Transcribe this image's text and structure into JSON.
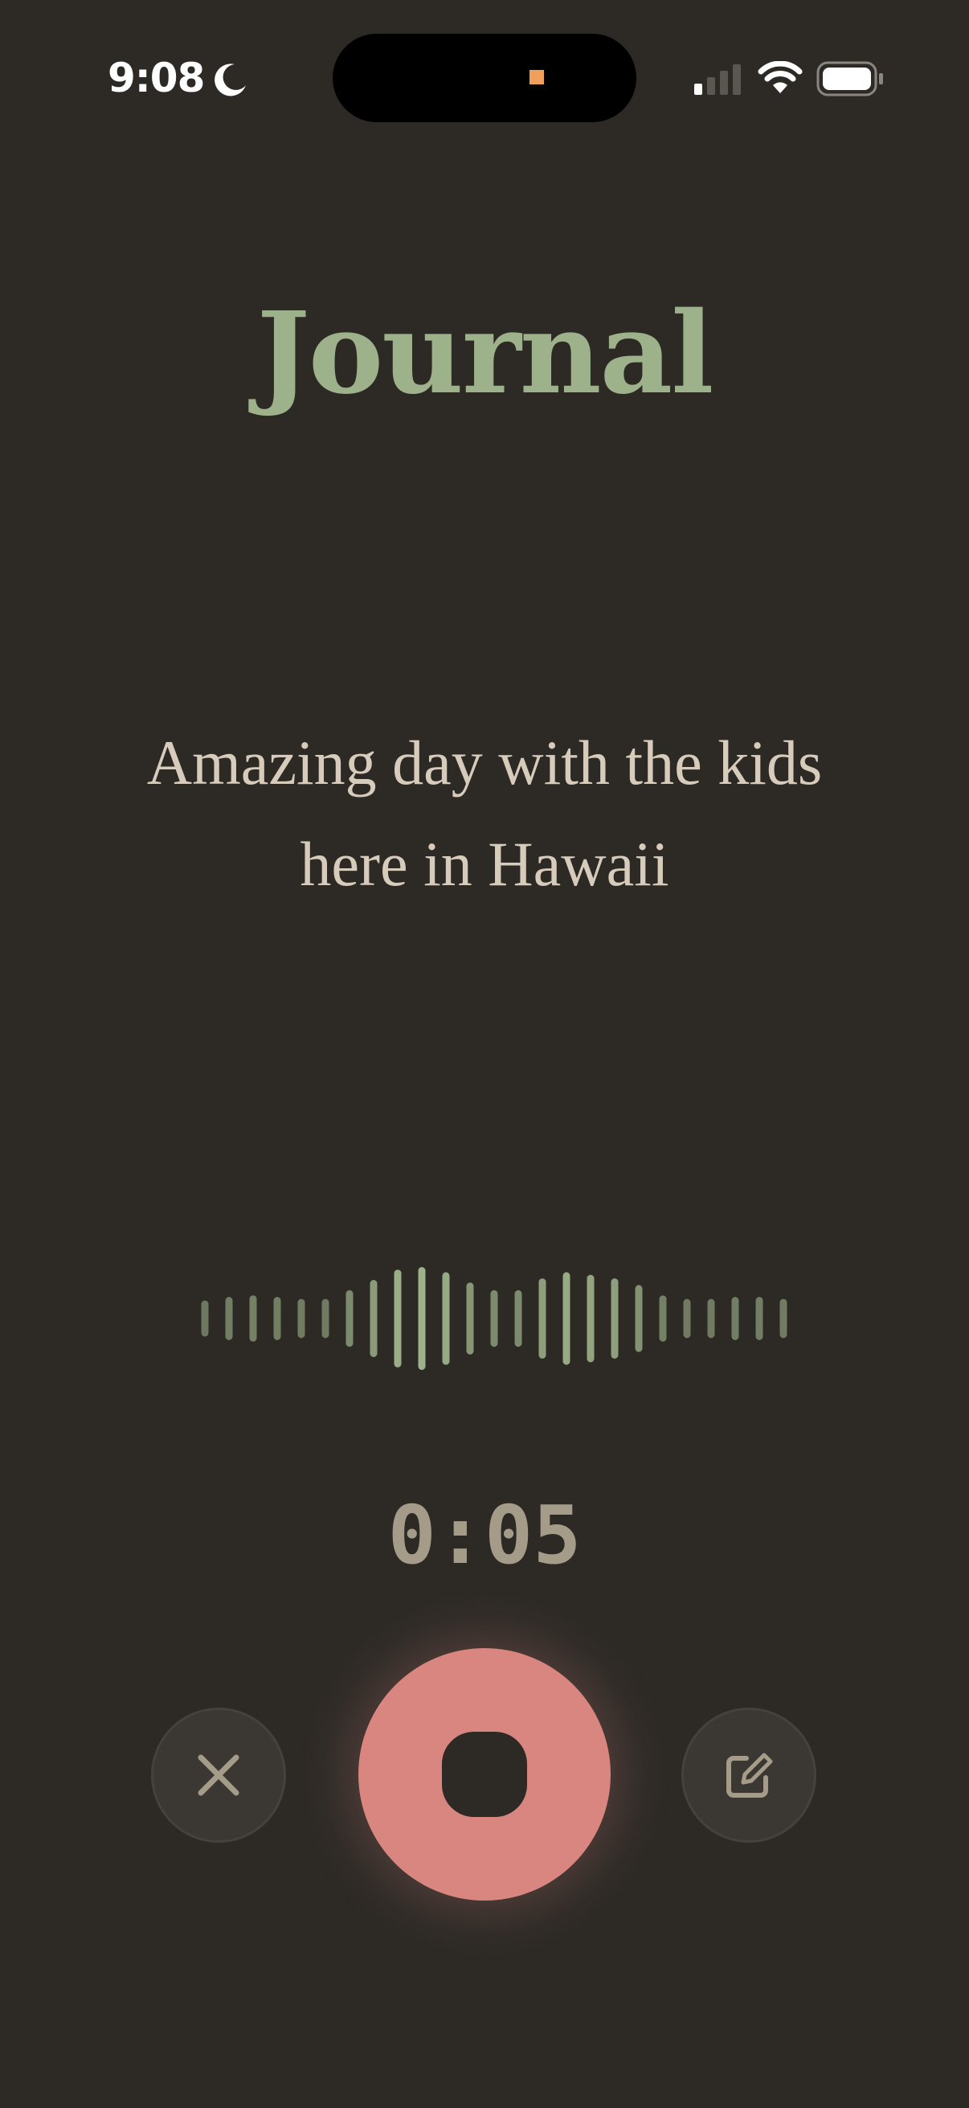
{
  "status_bar": {
    "time": "9:08",
    "icons": [
      "moon-icon",
      "cellular-signal-icon",
      "wifi-icon",
      "battery-icon"
    ]
  },
  "title": "Journal",
  "transcript": "Amazing day with the kids here in Hawaii",
  "timer": "0:05",
  "controls": {
    "cancel_icon": "close-icon",
    "record_icon": "stop-icon",
    "edit_icon": "compose-icon"
  },
  "colors": {
    "background": "#2d2a26",
    "title": "#9db28a",
    "record_button": "#d8867f",
    "waveform": "#9db28a"
  },
  "waveform": {
    "levels": [
      0.35,
      0.42,
      0.45,
      0.42,
      0.38,
      0.38,
      0.55,
      0.75,
      0.95,
      1.0,
      0.9,
      0.7,
      0.55,
      0.55,
      0.78,
      0.9,
      0.85,
      0.78,
      0.65,
      0.45,
      0.38,
      0.38,
      0.42,
      0.42,
      0.38
    ]
  }
}
